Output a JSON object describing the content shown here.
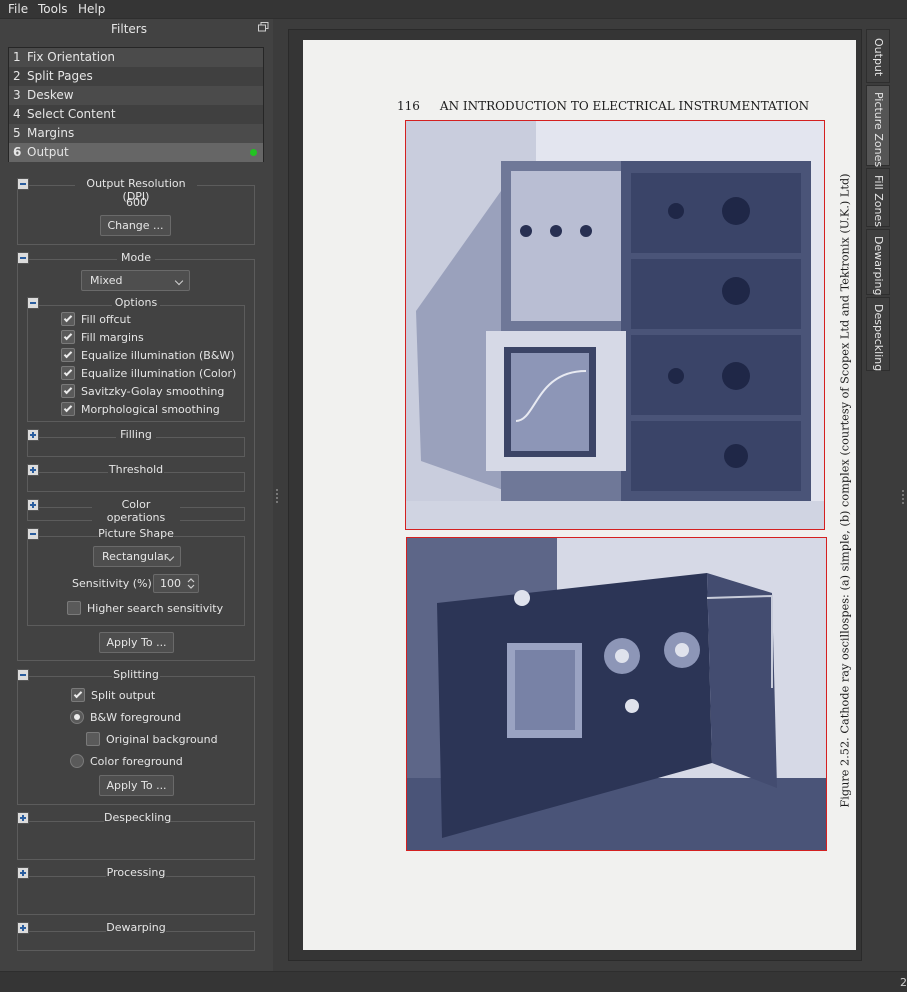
{
  "menu": [
    "File",
    "Tools",
    "Help"
  ],
  "panel": {
    "title": "Filters",
    "filters": [
      {
        "num": "1",
        "label": "Fix Orientation"
      },
      {
        "num": "2",
        "label": "Split Pages"
      },
      {
        "num": "3",
        "label": "Deskew"
      },
      {
        "num": "4",
        "label": "Select Content"
      },
      {
        "num": "5",
        "label": "Margins"
      },
      {
        "num": "6",
        "label": "Output"
      }
    ],
    "selected_filter": "6"
  },
  "resolution": {
    "title": "Output Resolution (DPI)",
    "value": "600",
    "change_button": "Change ..."
  },
  "mode": {
    "title": "Mode",
    "selected": "Mixed",
    "options_title": "Options",
    "options": [
      {
        "label": "Fill offcut",
        "checked": true
      },
      {
        "label": "Fill margins",
        "checked": true
      },
      {
        "label": "Equalize illumination (B&W)",
        "checked": true
      },
      {
        "label": "Equalize illumination (Color)",
        "checked": true
      },
      {
        "label": "Savitzky-Golay smoothing",
        "checked": true
      },
      {
        "label": "Morphological smoothing",
        "checked": true
      }
    ],
    "filling_title": "Filling",
    "threshold_title": "Threshold",
    "color_ops_title": "Color operations",
    "picture_shape": {
      "title": "Picture Shape",
      "selected": "Rectangular",
      "sensitivity_label": "Sensitivity (%):",
      "sensitivity_value": "100",
      "higher_search_label": "Higher search sensitivity",
      "higher_search_checked": false
    },
    "apply_button": "Apply To ..."
  },
  "splitting": {
    "title": "Splitting",
    "split_output_label": "Split output",
    "split_output_checked": true,
    "bw_foreground_label": "B&W foreground",
    "original_background_label": "Original background",
    "color_foreground_label": "Color foreground",
    "selected_radio": "B&W foreground",
    "apply_button": "Apply To ..."
  },
  "despeckling": {
    "title": "Despeckling"
  },
  "processing": {
    "title": "Processing"
  },
  "dewarping": {
    "title": "Dewarping"
  },
  "page": {
    "page_number": "116",
    "header": "AN INTRODUCTION TO ELECTRICAL INSTRUMENTATION",
    "caption": "Figure 2.52.   Cathode ray oscillospes: (a) simple, (b) complex   (courtesy of Scopex  Ltd and Tektronix (U.K.) Ltd)"
  },
  "side_tabs": [
    "Output",
    "Picture Zones",
    "Fill Zones",
    "Dewarping",
    "Despeckling"
  ],
  "active_side_tab": "Picture Zones",
  "status_text": "2",
  "colors": {
    "zone_border": "#d42020",
    "status_ok": "#22c322",
    "photo_tint": "#3f4f7a"
  }
}
